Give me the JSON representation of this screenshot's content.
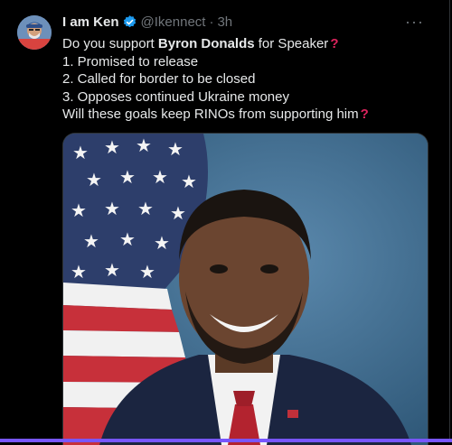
{
  "tweet": {
    "author_name": "I am Ken",
    "handle": "@Ikennect",
    "separator": "·",
    "time": "3h",
    "more_label": "···",
    "verified": true,
    "line1_pre": "Do you support ",
    "line1_bold": "Byron Donalds",
    "line1_post": " for Speaker",
    "line2": "1.  Promised to release",
    "line3": "2. Called for border to be closed",
    "line4": "3. Opposes continued Ukraine money",
    "line5": "Will these goals keep RINOs from supporting him",
    "question_mark": "?"
  },
  "colors": {
    "background": "#000000",
    "text": "#e7e9ea",
    "muted": "#71767b",
    "verified": "#1d9bf0",
    "question": "#e0245e",
    "accent_bar": "#7856ff"
  },
  "icons": {
    "verified": "verified-badge-icon",
    "more": "more-options-icon",
    "question": "red-question-mark-emoji"
  }
}
